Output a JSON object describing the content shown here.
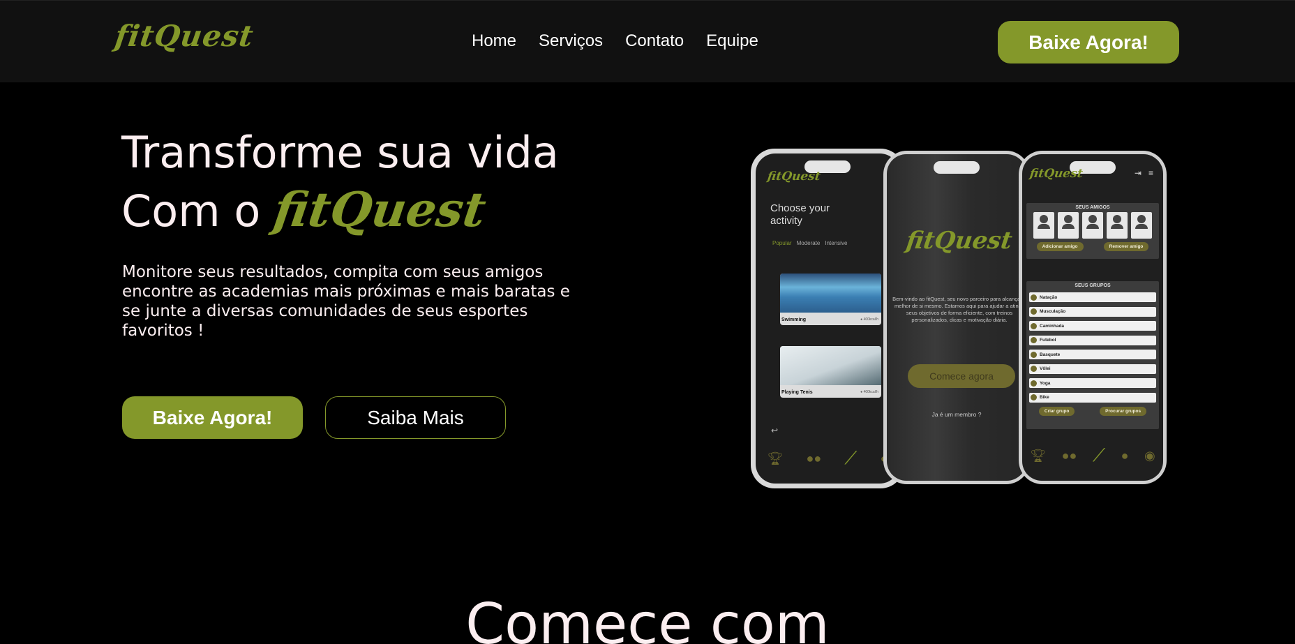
{
  "header": {
    "logo": "fitQuest",
    "nav": [
      "Home",
      "Serviços",
      "Contato",
      "Equipe"
    ],
    "cta": "Baixe Agora!"
  },
  "hero": {
    "title_line1": "Transforme sua vida",
    "title_line2_prefix": "Com o",
    "title_brand": "fitQuest",
    "description": "Monitore seus resultados, compita com seus amigos encontre as academias mais próximas e mais baratas e se junte a diversas comunidades de seus esportes favoritos !",
    "primary_button": "Baixe Agora!",
    "secondary_button": "Saiba Mais"
  },
  "phone1": {
    "logo": "fitQuest",
    "title": "Choose your activity",
    "tabs": [
      "Popular",
      "Moderate",
      "Intensive"
    ],
    "cards": [
      {
        "label": "Swimming",
        "tag": "● 400kcal/h"
      },
      {
        "label": "Playing Tenis",
        "tag": "● 400kcal/h"
      }
    ]
  },
  "phone2": {
    "logo": "fitQuest",
    "description": "Bem-vindo ao fitQuest, seu novo parceiro para alcançar o melhor de si mesmo. Estamos aqui para ajudar a atingir seus objetivos de forma eficiente, com treinos personalizados, dicas e motivação diária.",
    "button": "Comece agora",
    "member": "Ja é um membro ?"
  },
  "phone3": {
    "logo": "fitQuest",
    "friends_title": "SEUS AMIGOS",
    "friends_buttons": [
      "Adicionar amigo",
      "Remover amigo"
    ],
    "groups_title": "SEUS GRUPOS",
    "groups": [
      "Natação",
      "Musculação",
      "Caminhada",
      "Futebol",
      "Basquete",
      "Vôlei",
      "Yoga",
      "Bike"
    ],
    "groups_buttons": [
      "Criar grupo",
      "Procurar grupos"
    ]
  },
  "section": {
    "title": "Comece com"
  },
  "colors": {
    "accent": "#84982a",
    "background": "#000000",
    "header_bg": "#111111",
    "text": "#fbeef0"
  }
}
